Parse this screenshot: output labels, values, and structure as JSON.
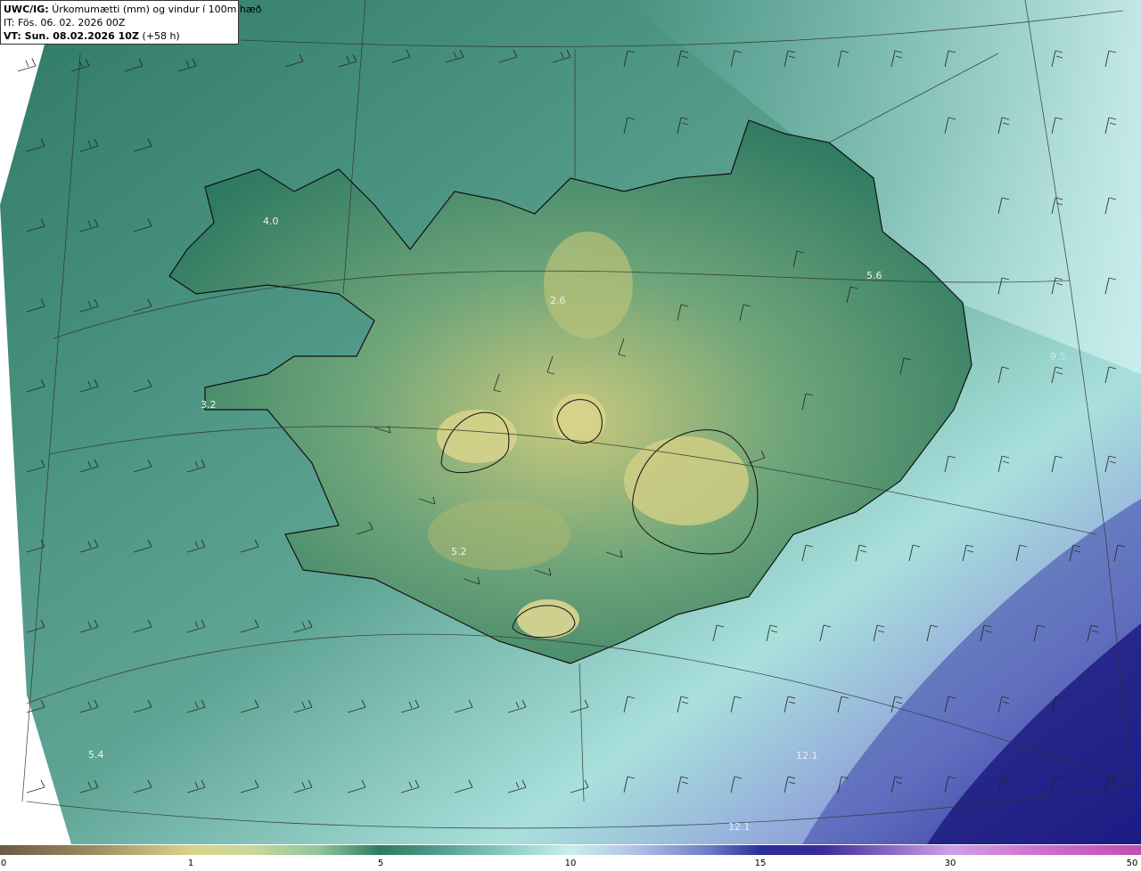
{
  "header": {
    "model": "UWC/IG:",
    "title": "Úrkomumætti (mm) og vindur í 100m hæð",
    "init_time": "IT: Fös. 06. 02. 2026 00Z",
    "valid_prefix": "VT: Sun. 08.02.2026 10Z",
    "valid_suffix": "(+58 h)"
  },
  "labels": {
    "westfjords": "4.0",
    "snaefellsnes": "3.2",
    "north": "2.6",
    "east": "5.6",
    "south": "5.2",
    "southwest_sea": "5.4",
    "southeast_sea": "12.1",
    "bottom_sea": "12.1",
    "east_sea": "9.5"
  },
  "colorbar": {
    "ticks": [
      "0",
      "1",
      "5",
      "10",
      "15",
      "30",
      "50"
    ],
    "tick_positions": [
      0,
      16.7,
      33.3,
      50,
      66.7,
      83.3,
      100
    ]
  },
  "colors": {
    "ocean": "#3e8a76",
    "land_low": "#2f7a62",
    "land_high": "#d9d38a",
    "heavy": "#2a2c9a",
    "coast": "#111111",
    "barb": "#222222"
  }
}
